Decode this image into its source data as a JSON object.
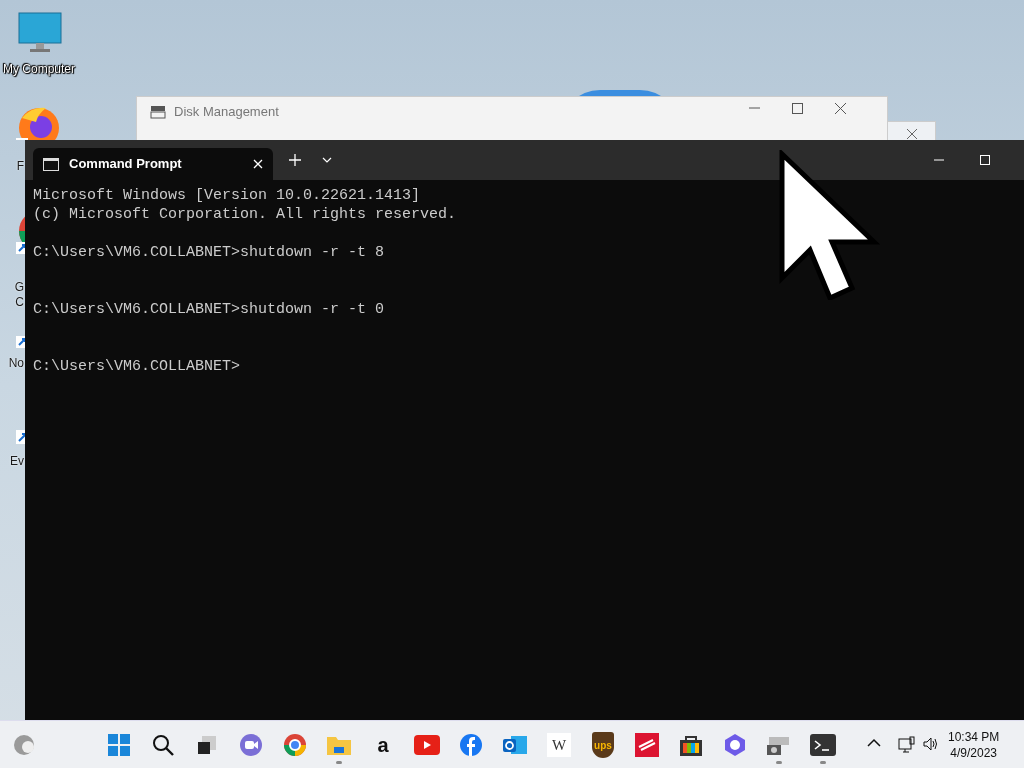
{
  "desktop_icons": [
    {
      "kind": "monitor",
      "label": "My Computer"
    },
    {
      "kind": "firefox",
      "label": "F"
    },
    {
      "kind": "chrome",
      "label": "G\nC"
    },
    {
      "kind": "notepad",
      "label": "No"
    },
    {
      "kind": "shortcut",
      "label": "Ev"
    }
  ],
  "background_windows": [
    {
      "title": "Disk Management"
    }
  ],
  "terminal": {
    "tabs": [
      {
        "title": "Command Prompt",
        "selected": true
      }
    ],
    "lines": [
      {
        "kind": "banner",
        "text": "Microsoft Windows [Version 10.0.22621.1413]"
      },
      {
        "kind": "banner",
        "text": "(c) Microsoft Corporation. All rights reserved."
      },
      {
        "kind": "command",
        "text": "C:\\Users\\VM6.COLLABNET>shutdown -r -t 8"
      },
      {
        "kind": "command",
        "text": "C:\\Users\\VM6.COLLABNET>shutdown -r -t 0"
      },
      {
        "kind": "command",
        "text": "C:\\Users\\VM6.COLLABNET>"
      }
    ]
  },
  "taskbar": {
    "items": [
      {
        "kind": "start",
        "running": false
      },
      {
        "kind": "search",
        "running": false
      },
      {
        "kind": "taskview",
        "running": false
      },
      {
        "kind": "teams",
        "running": false
      },
      {
        "kind": "chrome",
        "running": false
      },
      {
        "kind": "folder",
        "running": true
      },
      {
        "kind": "amazon",
        "glyph": "a",
        "running": false
      },
      {
        "kind": "youtube",
        "running": false
      },
      {
        "kind": "facebook",
        "running": false
      },
      {
        "kind": "outlook",
        "running": false
      },
      {
        "kind": "wiki",
        "glyph": "W",
        "running": false
      },
      {
        "kind": "ups",
        "glyph": "ups",
        "running": false
      },
      {
        "kind": "bank",
        "running": false
      },
      {
        "kind": "store",
        "running": false
      },
      {
        "kind": "copilot",
        "running": false
      },
      {
        "kind": "vm",
        "running": true
      },
      {
        "kind": "terminal",
        "running": true
      }
    ],
    "clock": {
      "time": "10:34 PM",
      "date": "4/9/2023"
    }
  }
}
